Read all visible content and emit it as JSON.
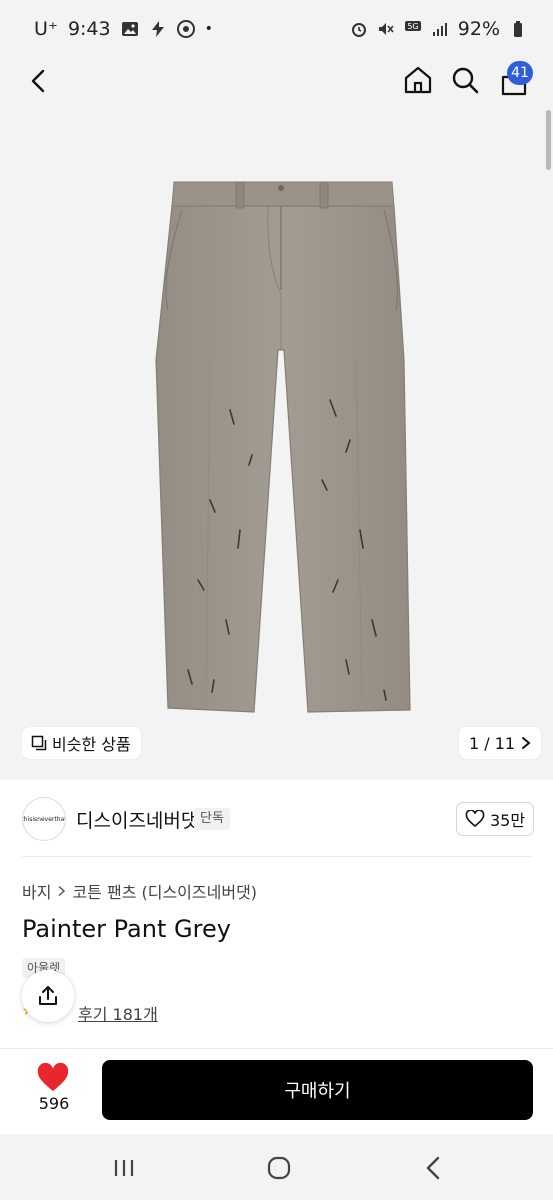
{
  "status_bar": {
    "carrier": "U⁺",
    "time": "9:43",
    "battery": "92%"
  },
  "header": {
    "back_icon": "chevron-left-icon",
    "home_icon": "home-icon",
    "search_icon": "search-icon",
    "cart_icon": "shopping-bag-icon",
    "cart_count": "41"
  },
  "gallery": {
    "similar_label": "비슷한 상품",
    "page_indicator": "1 / 11"
  },
  "brand": {
    "logo_text": "thisisneverthat",
    "name": "디스이즈네버댓",
    "exclusive_tag": "단독",
    "likes": "35만"
  },
  "product": {
    "breadcrumb": [
      "바지",
      "코튼 팬츠 (디스이즈네버댓)"
    ],
    "title": "Painter Pant Grey",
    "tag": "아울렛",
    "reviews": "후기 181개"
  },
  "bottom_bar": {
    "heart_count": "596",
    "buy_label": "구매하기"
  },
  "colors": {
    "accent_badge": "#2f5fd8",
    "heart_red": "#e8262c",
    "buy_button": "#000000"
  }
}
